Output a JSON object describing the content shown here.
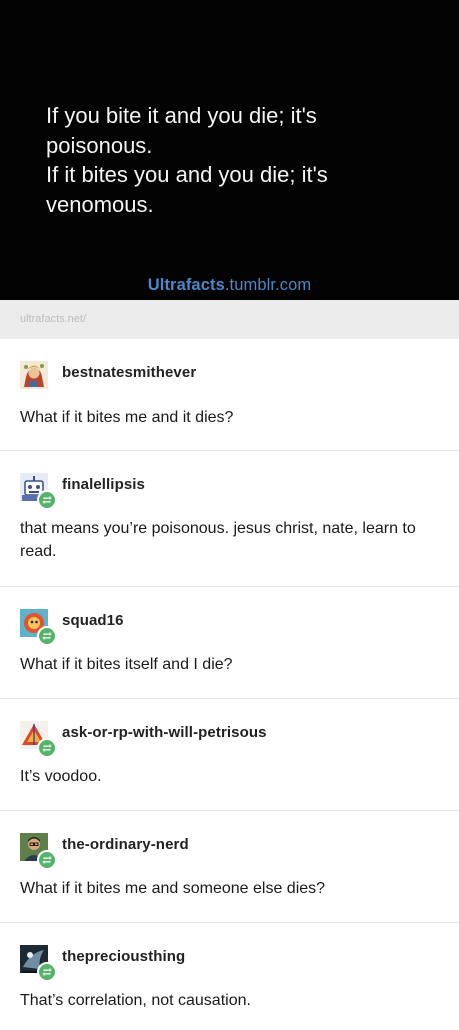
{
  "hero": {
    "lines": [
      "If you bite it and you die; it's",
      "poisonous.",
      "If it bites you and you die; it's",
      "venomous."
    ],
    "brand_bold": "Ultrafacts",
    "brand_rest": ".tumblr.com"
  },
  "source": {
    "link_text": "ultrafacts.net/"
  },
  "posts": [
    {
      "username": "bestnatesmithever",
      "text": "What if it bites me and it dies?",
      "avatar_icon": "portrait-avatar-icon",
      "reblog": false
    },
    {
      "username": "finalellipsis",
      "text": "that means you’re poisonous. jesus christ, nate, learn to read.",
      "avatar_icon": "robot-avatar-icon",
      "reblog": true
    },
    {
      "username": "squad16",
      "text": "What if it bites itself and I die?",
      "avatar_icon": "round-creature-avatar-icon",
      "reblog": true
    },
    {
      "username": "ask-or-rp-with-will-petrisous",
      "text": "It’s voodoo.",
      "avatar_icon": "triangle-avatar-icon",
      "reblog": true
    },
    {
      "username": "the-ordinary-nerd",
      "text": "What if it bites me and someone else dies?",
      "avatar_icon": "person-avatar-icon",
      "reblog": true
    },
    {
      "username": "thepreciousthing",
      "text": "That’s correlation, not causation.",
      "avatar_icon": "dark-art-avatar-icon",
      "reblog": true
    }
  ],
  "colors": {
    "hero_bg": "#030303",
    "brand_blue": "#4d86c9",
    "reblog_green": "#56b36b",
    "source_bar_bg": "#ececec"
  }
}
